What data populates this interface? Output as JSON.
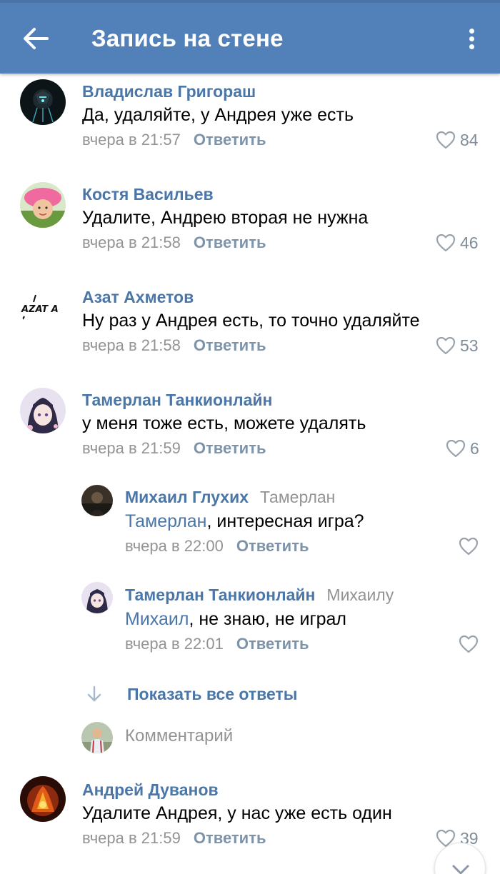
{
  "header": {
    "title": "Запись на стене",
    "back_icon": "arrow-left-icon",
    "menu_icon": "more-vertical-icon",
    "color": "#5181b8"
  },
  "comments": [
    {
      "author": "Владислав Григораш",
      "text": "Да, удаляйте, у Андрея уже есть",
      "time": "вчера в 21:57",
      "reply": "Ответить",
      "likes": "84"
    },
    {
      "author": "Костя Васильев",
      "text": "Удалите, Андрею вторая не нужна",
      "time": "вчера в 21:58",
      "reply": "Ответить",
      "likes": "46"
    },
    {
      "author": "Азат Ахметов",
      "avatar_text": "AZAT A",
      "text": "Ну раз у Андрея есть, то точно удаляйте",
      "time": "вчера в 21:58",
      "reply": "Ответить",
      "likes": "53"
    },
    {
      "author": "Тамерлан Танкионлайн",
      "text": "у меня тоже есть, можете удалять",
      "time": "вчера в 21:59",
      "reply": "Ответить",
      "likes": "6"
    }
  ],
  "replies": [
    {
      "author": "Михаил Глухих",
      "reply_to": "Тамерлан",
      "mention": "Тамерлан",
      "text": ", интересная игра?",
      "time": "вчера в 22:00",
      "reply": "Ответить",
      "likes": ""
    },
    {
      "author": "Тамерлан Танкионлайн",
      "reply_to": "Михаилу",
      "mention": "Михаил",
      "text": ", не знаю, не играл",
      "time": "вчера в 22:01",
      "reply": "Ответить",
      "likes": ""
    }
  ],
  "show_all": "Показать все ответы",
  "comment_placeholder": "Комментарий",
  "last_comment": {
    "author": "Андрей Дуванов",
    "text": "Удалите Андрея, у нас уже есть один",
    "time": "вчера в 21:59",
    "reply": "Ответить",
    "likes": "39"
  },
  "colors": {
    "link": "#4a76a8",
    "meta": "#939393"
  }
}
